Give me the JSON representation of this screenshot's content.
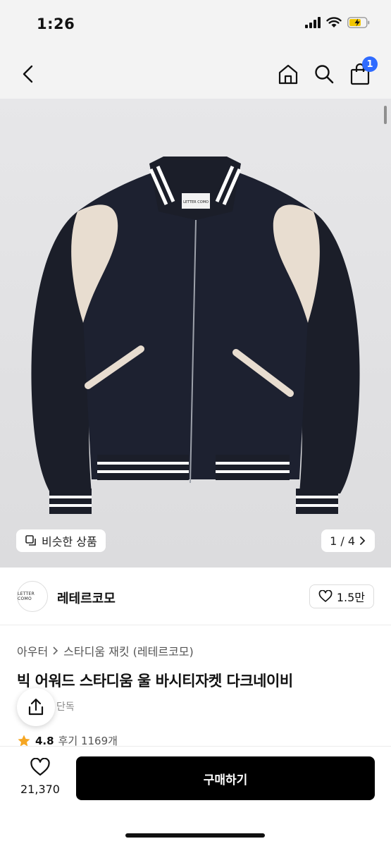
{
  "status": {
    "time": "1:26"
  },
  "nav": {
    "cart_count": "1"
  },
  "hero": {
    "similar_label": "비슷한 상품",
    "page_indicator": "1 / 4",
    "jacket_logo_text": "LETTER COMO"
  },
  "brand": {
    "logo_text": "LETTER COMO",
    "name": "레테르코모",
    "likes": "1.5만"
  },
  "breadcrumb": {
    "category": "아우터",
    "subcategory": "스타디움 재킷 (레테르코모)"
  },
  "product": {
    "title": "빅 어워드 스타디움 울 바시티자켓 다크네이비",
    "exclusive_tag": "단독",
    "rating": "4.8",
    "reviews": "후기 1169개"
  },
  "bottom": {
    "wish_count": "21,370",
    "buy_label": "구매하기"
  },
  "colors": {
    "accent": "#2f6bff",
    "buy_button": "#000000",
    "star": "#f5a623"
  }
}
